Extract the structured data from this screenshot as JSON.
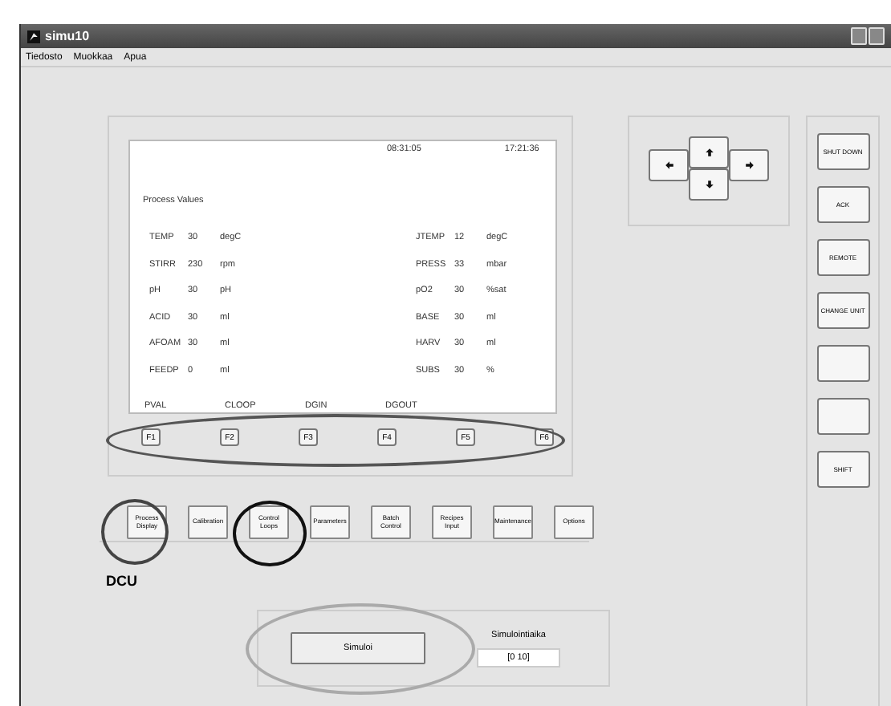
{
  "window": {
    "title": "simu10"
  },
  "menu": [
    "Tiedosto",
    "Muokkaa",
    "Apua"
  ],
  "display": {
    "date": "08:31:05",
    "time": "17:21:36",
    "heading": "Process Values",
    "left": [
      {
        "name": "TEMP",
        "value": "30",
        "unit": "degC"
      },
      {
        "name": "STIRR",
        "value": "230",
        "unit": "rpm"
      },
      {
        "name": "pH",
        "value": "30",
        "unit": "pH"
      },
      {
        "name": "ACID",
        "value": "30",
        "unit": "ml"
      },
      {
        "name": "AFOAM",
        "value": "30",
        "unit": "ml"
      },
      {
        "name": "FEEDP",
        "value": "0",
        "unit": "ml"
      }
    ],
    "right": [
      {
        "name": "JTEMP",
        "value": "12",
        "unit": "degC"
      },
      {
        "name": "PRESS",
        "value": "33",
        "unit": "mbar"
      },
      {
        "name": "pO2",
        "value": "30",
        "unit": "%sat"
      },
      {
        "name": "BASE",
        "value": "30",
        "unit": "ml"
      },
      {
        "name": "HARV",
        "value": "30",
        "unit": "ml"
      },
      {
        "name": "SUBS",
        "value": "30",
        "unit": "%"
      }
    ],
    "softkeys": [
      "PVAL",
      "CLOOP",
      "DGIN",
      "DGOUT"
    ]
  },
  "function_keys": [
    "F1",
    "F2",
    "F3",
    "F4",
    "F5",
    "F6"
  ],
  "side_buttons": [
    {
      "kind": "labeled",
      "label": "SHUT DOWN"
    },
    {
      "kind": "labeled",
      "label": "ACK"
    },
    {
      "kind": "labeled",
      "label": "REMOTE"
    },
    {
      "kind": "labeled",
      "label": "CHANGE UNIT"
    },
    {
      "kind": "blank"
    },
    {
      "kind": "blank"
    },
    {
      "kind": "labeled",
      "label": "SHIFT"
    }
  ],
  "menu_buttons": [
    "Process Display",
    "Calibration",
    "Control Loops",
    "Parameters",
    "Batch Control",
    "Recipes Input",
    "Maintenance",
    "Options"
  ],
  "unit_label": "DCU",
  "simulation": {
    "button": "Simuloi",
    "label": "Simulointiaika",
    "value": "[0 10]"
  },
  "annotations": [
    {
      "color": "#555555"
    },
    {
      "color": "#444444"
    },
    {
      "color": "#111111"
    },
    {
      "color": "#aaaaaa"
    }
  ]
}
